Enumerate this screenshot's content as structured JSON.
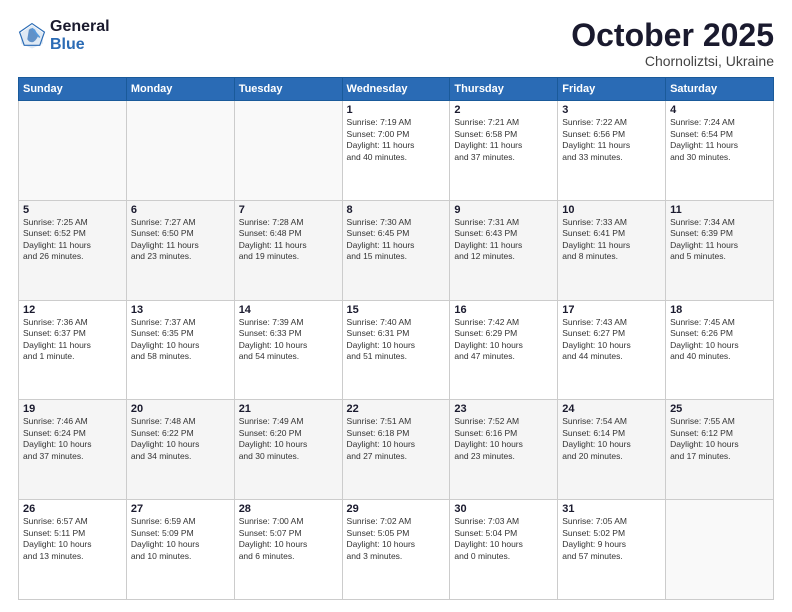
{
  "header": {
    "logo_line1": "General",
    "logo_line2": "Blue",
    "month": "October 2025",
    "location": "Chornoliztsi, Ukraine"
  },
  "weekdays": [
    "Sunday",
    "Monday",
    "Tuesday",
    "Wednesday",
    "Thursday",
    "Friday",
    "Saturday"
  ],
  "weeks": [
    [
      {
        "day": "",
        "info": ""
      },
      {
        "day": "",
        "info": ""
      },
      {
        "day": "",
        "info": ""
      },
      {
        "day": "1",
        "info": "Sunrise: 7:19 AM\nSunset: 7:00 PM\nDaylight: 11 hours\nand 40 minutes."
      },
      {
        "day": "2",
        "info": "Sunrise: 7:21 AM\nSunset: 6:58 PM\nDaylight: 11 hours\nand 37 minutes."
      },
      {
        "day": "3",
        "info": "Sunrise: 7:22 AM\nSunset: 6:56 PM\nDaylight: 11 hours\nand 33 minutes."
      },
      {
        "day": "4",
        "info": "Sunrise: 7:24 AM\nSunset: 6:54 PM\nDaylight: 11 hours\nand 30 minutes."
      }
    ],
    [
      {
        "day": "5",
        "info": "Sunrise: 7:25 AM\nSunset: 6:52 PM\nDaylight: 11 hours\nand 26 minutes."
      },
      {
        "day": "6",
        "info": "Sunrise: 7:27 AM\nSunset: 6:50 PM\nDaylight: 11 hours\nand 23 minutes."
      },
      {
        "day": "7",
        "info": "Sunrise: 7:28 AM\nSunset: 6:48 PM\nDaylight: 11 hours\nand 19 minutes."
      },
      {
        "day": "8",
        "info": "Sunrise: 7:30 AM\nSunset: 6:45 PM\nDaylight: 11 hours\nand 15 minutes."
      },
      {
        "day": "9",
        "info": "Sunrise: 7:31 AM\nSunset: 6:43 PM\nDaylight: 11 hours\nand 12 minutes."
      },
      {
        "day": "10",
        "info": "Sunrise: 7:33 AM\nSunset: 6:41 PM\nDaylight: 11 hours\nand 8 minutes."
      },
      {
        "day": "11",
        "info": "Sunrise: 7:34 AM\nSunset: 6:39 PM\nDaylight: 11 hours\nand 5 minutes."
      }
    ],
    [
      {
        "day": "12",
        "info": "Sunrise: 7:36 AM\nSunset: 6:37 PM\nDaylight: 11 hours\nand 1 minute."
      },
      {
        "day": "13",
        "info": "Sunrise: 7:37 AM\nSunset: 6:35 PM\nDaylight: 10 hours\nand 58 minutes."
      },
      {
        "day": "14",
        "info": "Sunrise: 7:39 AM\nSunset: 6:33 PM\nDaylight: 10 hours\nand 54 minutes."
      },
      {
        "day": "15",
        "info": "Sunrise: 7:40 AM\nSunset: 6:31 PM\nDaylight: 10 hours\nand 51 minutes."
      },
      {
        "day": "16",
        "info": "Sunrise: 7:42 AM\nSunset: 6:29 PM\nDaylight: 10 hours\nand 47 minutes."
      },
      {
        "day": "17",
        "info": "Sunrise: 7:43 AM\nSunset: 6:27 PM\nDaylight: 10 hours\nand 44 minutes."
      },
      {
        "day": "18",
        "info": "Sunrise: 7:45 AM\nSunset: 6:26 PM\nDaylight: 10 hours\nand 40 minutes."
      }
    ],
    [
      {
        "day": "19",
        "info": "Sunrise: 7:46 AM\nSunset: 6:24 PM\nDaylight: 10 hours\nand 37 minutes."
      },
      {
        "day": "20",
        "info": "Sunrise: 7:48 AM\nSunset: 6:22 PM\nDaylight: 10 hours\nand 34 minutes."
      },
      {
        "day": "21",
        "info": "Sunrise: 7:49 AM\nSunset: 6:20 PM\nDaylight: 10 hours\nand 30 minutes."
      },
      {
        "day": "22",
        "info": "Sunrise: 7:51 AM\nSunset: 6:18 PM\nDaylight: 10 hours\nand 27 minutes."
      },
      {
        "day": "23",
        "info": "Sunrise: 7:52 AM\nSunset: 6:16 PM\nDaylight: 10 hours\nand 23 minutes."
      },
      {
        "day": "24",
        "info": "Sunrise: 7:54 AM\nSunset: 6:14 PM\nDaylight: 10 hours\nand 20 minutes."
      },
      {
        "day": "25",
        "info": "Sunrise: 7:55 AM\nSunset: 6:12 PM\nDaylight: 10 hours\nand 17 minutes."
      }
    ],
    [
      {
        "day": "26",
        "info": "Sunrise: 6:57 AM\nSunset: 5:11 PM\nDaylight: 10 hours\nand 13 minutes."
      },
      {
        "day": "27",
        "info": "Sunrise: 6:59 AM\nSunset: 5:09 PM\nDaylight: 10 hours\nand 10 minutes."
      },
      {
        "day": "28",
        "info": "Sunrise: 7:00 AM\nSunset: 5:07 PM\nDaylight: 10 hours\nand 6 minutes."
      },
      {
        "day": "29",
        "info": "Sunrise: 7:02 AM\nSunset: 5:05 PM\nDaylight: 10 hours\nand 3 minutes."
      },
      {
        "day": "30",
        "info": "Sunrise: 7:03 AM\nSunset: 5:04 PM\nDaylight: 10 hours\nand 0 minutes."
      },
      {
        "day": "31",
        "info": "Sunrise: 7:05 AM\nSunset: 5:02 PM\nDaylight: 9 hours\nand 57 minutes."
      },
      {
        "day": "",
        "info": ""
      }
    ]
  ]
}
